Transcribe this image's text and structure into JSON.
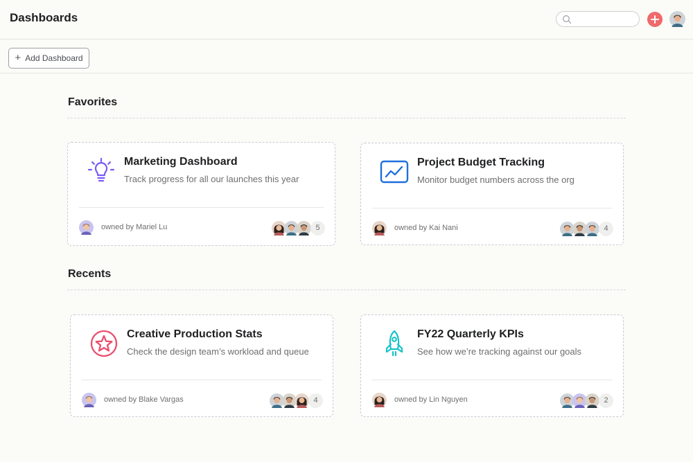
{
  "header": {
    "title": "Dashboards",
    "search_value": "",
    "search_icon": "search-icon",
    "add_icon": "plus-icon",
    "accent": "#f06a6a"
  },
  "toolbar": {
    "add_label": "Add Dashboard"
  },
  "sections": {
    "favorites": "Favorites",
    "recents": "Recents"
  },
  "favorites": [
    {
      "title": "Marketing Dashboard",
      "description": "Track progress for all our launches this year",
      "icon": "lightbulb-icon",
      "icon_color": "#7a5af5",
      "owner": "owned by Mariel Lu",
      "member_count": "5"
    },
    {
      "title": "Project Budget Tracking",
      "description": "Monitor budget numbers across the org",
      "icon": "line-chart-icon",
      "icon_color": "#1f6fdc",
      "owner": "owned by Kai Nani",
      "member_count": "4"
    }
  ],
  "recents": [
    {
      "title": "Creative Production Stats",
      "description": "Check the design team’s workload and queue",
      "icon": "star-icon",
      "icon_color": "#ea4e6e",
      "owner": "owned by Blake Vargas",
      "member_count": "4"
    },
    {
      "title": "FY22 Quarterly KPIs",
      "description": "See how we’re tracking against our goals",
      "icon": "rocket-icon",
      "icon_color": "#19c3c8",
      "owner": "owned by Lin Nguyen",
      "member_count": "2"
    }
  ]
}
